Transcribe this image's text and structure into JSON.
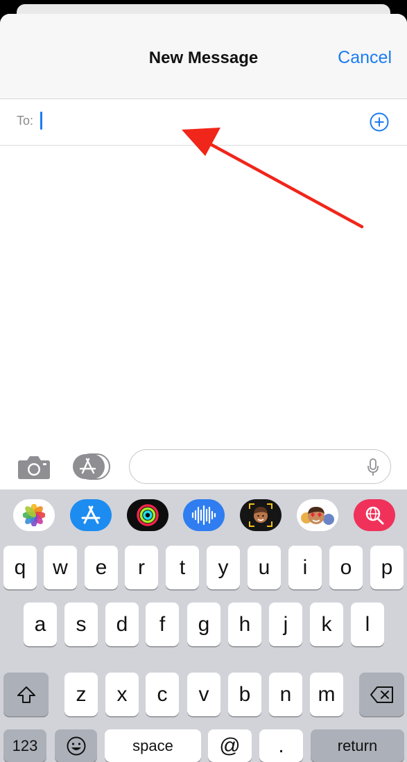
{
  "header": {
    "title": "New Message",
    "cancel_label": "Cancel"
  },
  "recipient": {
    "label": "To:"
  },
  "keyboard": {
    "row1": [
      "q",
      "w",
      "e",
      "r",
      "t",
      "y",
      "u",
      "i",
      "o",
      "p"
    ],
    "row2": [
      "a",
      "s",
      "d",
      "f",
      "g",
      "h",
      "j",
      "k",
      "l"
    ],
    "row3": [
      "z",
      "x",
      "c",
      "v",
      "b",
      "n",
      "m"
    ],
    "mode_label": "123",
    "space_label": "space",
    "at_label": "@",
    "period_label": ".",
    "return_label": "return"
  },
  "app_strip": [
    "photos-icon",
    "app-store-icon",
    "activity-icon",
    "audio-icon",
    "memoji-icon",
    "memoji-stickers-icon",
    "web-search-icon"
  ],
  "colors": {
    "accent": "#1a7bf2",
    "annotation_arrow": "#f0261b",
    "keyboard_bg": "#d1d3d9"
  }
}
